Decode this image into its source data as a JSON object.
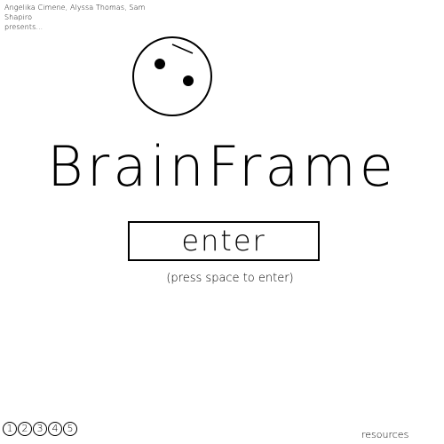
{
  "credits": {
    "line1": "Angelika Cimene, Alyssa Thomas, Sam Shapiro",
    "line2": "presents..."
  },
  "logo": {
    "icon": "face-icon"
  },
  "title": "BrainFrame",
  "enter_button": {
    "label": "enter"
  },
  "hint": "(press space to enter)",
  "pagination": {
    "pages": [
      "1",
      "2",
      "3",
      "4",
      "5"
    ]
  },
  "resources_link": "resources"
}
